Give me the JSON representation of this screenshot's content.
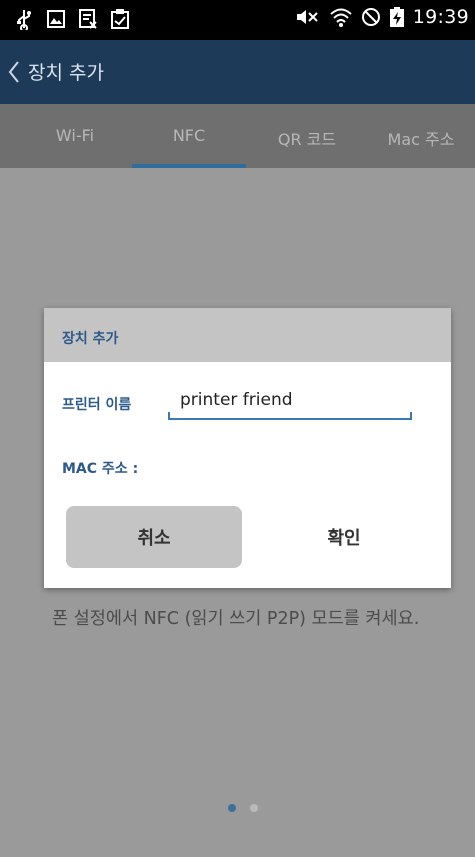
{
  "status_bar": {
    "time": "19:39",
    "left_icons": [
      "usb-icon",
      "image-icon",
      "document-icon",
      "clipboard-icon"
    ],
    "right_icons": [
      "mute-icon",
      "wifi-icon",
      "blocked-icon",
      "battery-charging-icon"
    ]
  },
  "app_bar": {
    "back_glyph": "〈",
    "title": "장치 추가"
  },
  "tabs": [
    {
      "label": "Wi-Fi"
    },
    {
      "label": "NFC"
    },
    {
      "label": "QR 코드"
    },
    {
      "label": "Mac 주소"
    }
  ],
  "active_tab": "NFC",
  "info_text": "폰 설정에서 NFC (읽기 쓰기 P2P) 모드를 켜세요.",
  "pager": {
    "total": 2,
    "current": 1
  },
  "dialog": {
    "title": "장치 추가",
    "printer_name_label": "프린터 이름",
    "printer_name_value": "printer friend",
    "mac_label": "MAC 주소",
    "mac_separator": ":",
    "cancel_label": "취소",
    "ok_label": "확인"
  },
  "colors": {
    "app_bar": "#1d3a59",
    "accent": "#2f6e9a",
    "dialog_label": "#2c5a8a",
    "dim_background": "#9a9a9a"
  }
}
